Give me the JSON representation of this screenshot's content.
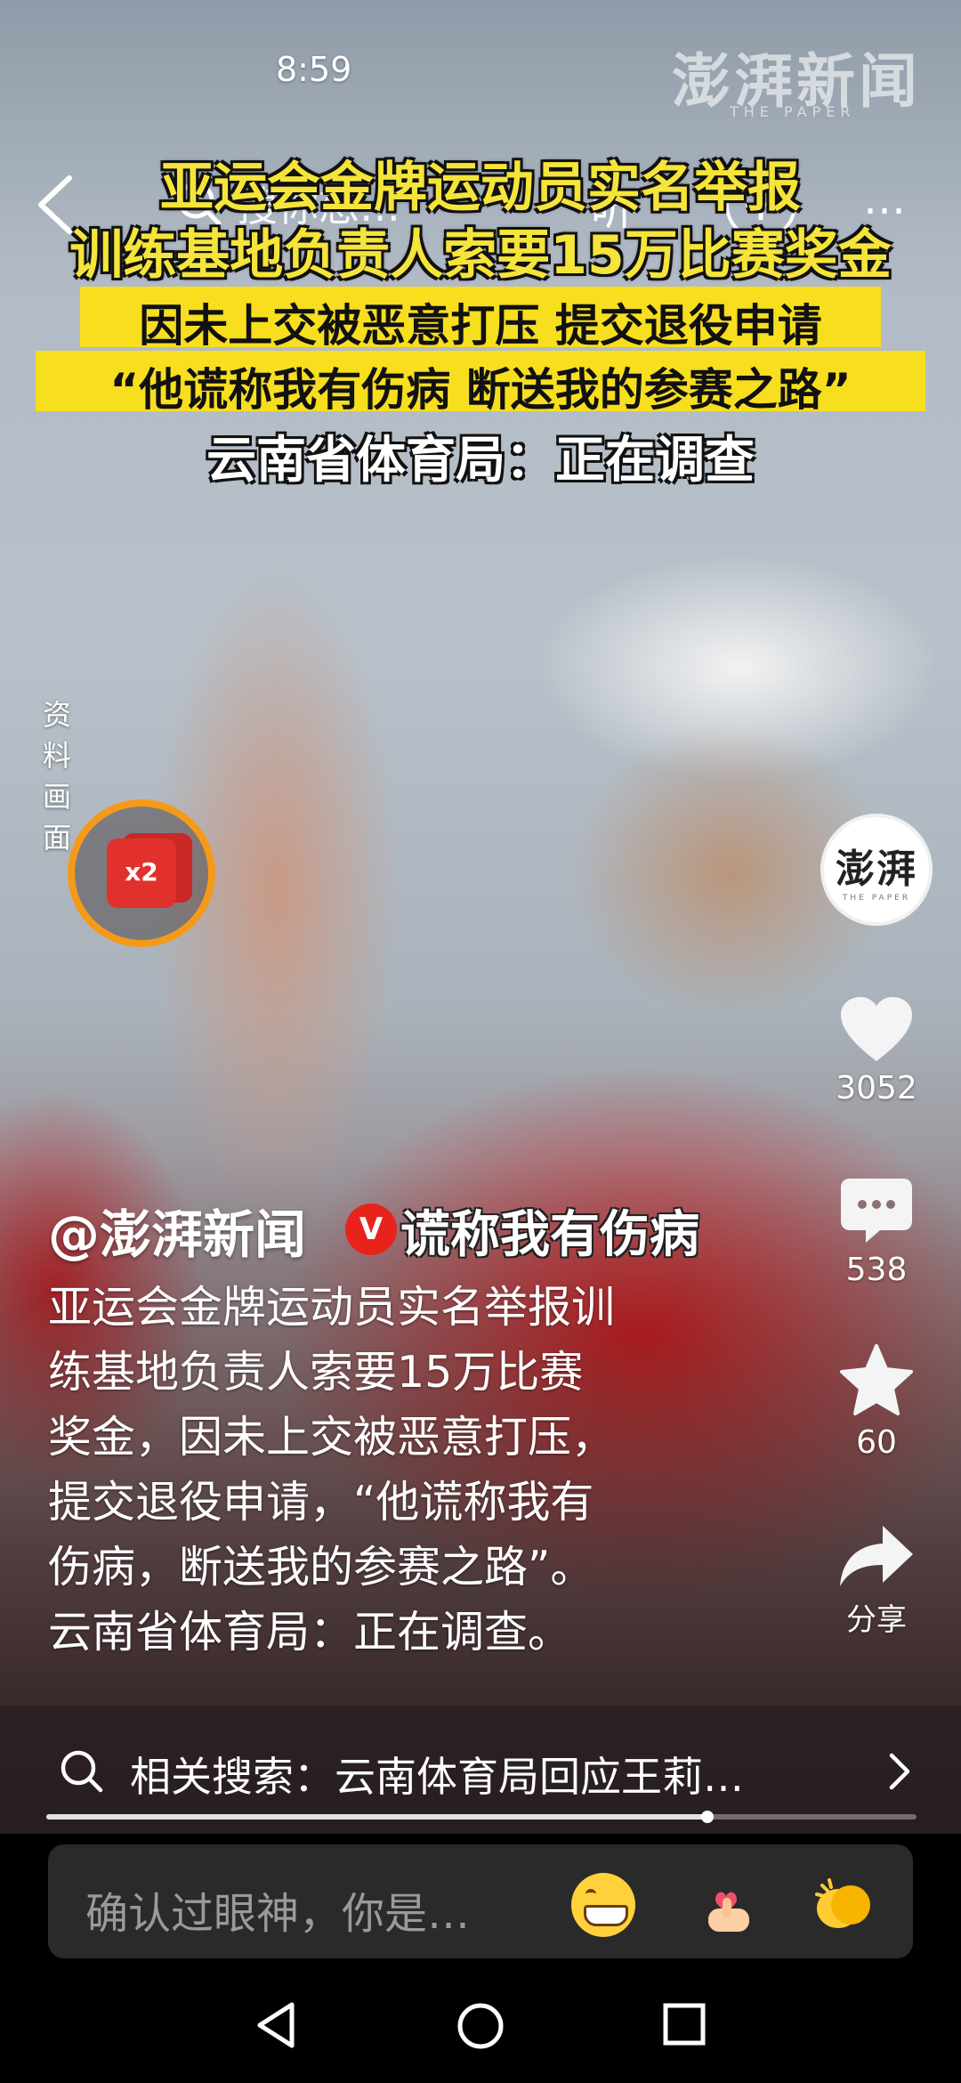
{
  "status_bar": {
    "time": "8:59"
  },
  "watermark": {
    "text": "澎湃新闻",
    "sub": "THE PAPER"
  },
  "top_nav": {
    "search_label": "搜你想…",
    "listen_label": "听",
    "more_label": "…"
  },
  "headline": {
    "line1": "亚运会金牌运动员实名举报",
    "line2": "训练基地负责人索要15万比赛奖金",
    "line3": "因未上交被恶意打压 提交退役申请",
    "line4": "“他谎称我有伤病 断送我的参赛之路”",
    "line5": "云南省体育局：正在调查"
  },
  "archive_label": "资料画面",
  "red_packet": {
    "multiplier": "x2"
  },
  "right_rail": {
    "avatar_logo": "澎湃",
    "avatar_logo_sub": "THE PAPER",
    "likes": "3052",
    "comments": "538",
    "favorites": "60",
    "share": "分享"
  },
  "caption": {
    "author": "@澎湃新闻",
    "verified_badge": "V",
    "subtitle": "谎称我有伤病",
    "description_lines": [
      "亚运会金牌运动员实名举报训",
      "练基地负责人索要15万比赛",
      "奖金，因未上交被恶意打压，",
      "提交退役申请，“他谎称我有",
      "伤病，断送我的参赛之路”。",
      "云南省体育局：正在调查。"
    ]
  },
  "related_search": {
    "text": "相关搜索：云南体育局回应王莉…"
  },
  "progress": {
    "fraction": 0.76
  },
  "comment_bar": {
    "placeholder": "确认过眼神，你是…",
    "emojis": [
      "grinning-face",
      "heart-hands",
      "clapping-hands"
    ]
  },
  "colors": {
    "headline_yellow": "#f5e43a",
    "band_yellow": "#f7de1f",
    "badge_red": "#e8231c",
    "ring_orange": "#f59a18"
  }
}
